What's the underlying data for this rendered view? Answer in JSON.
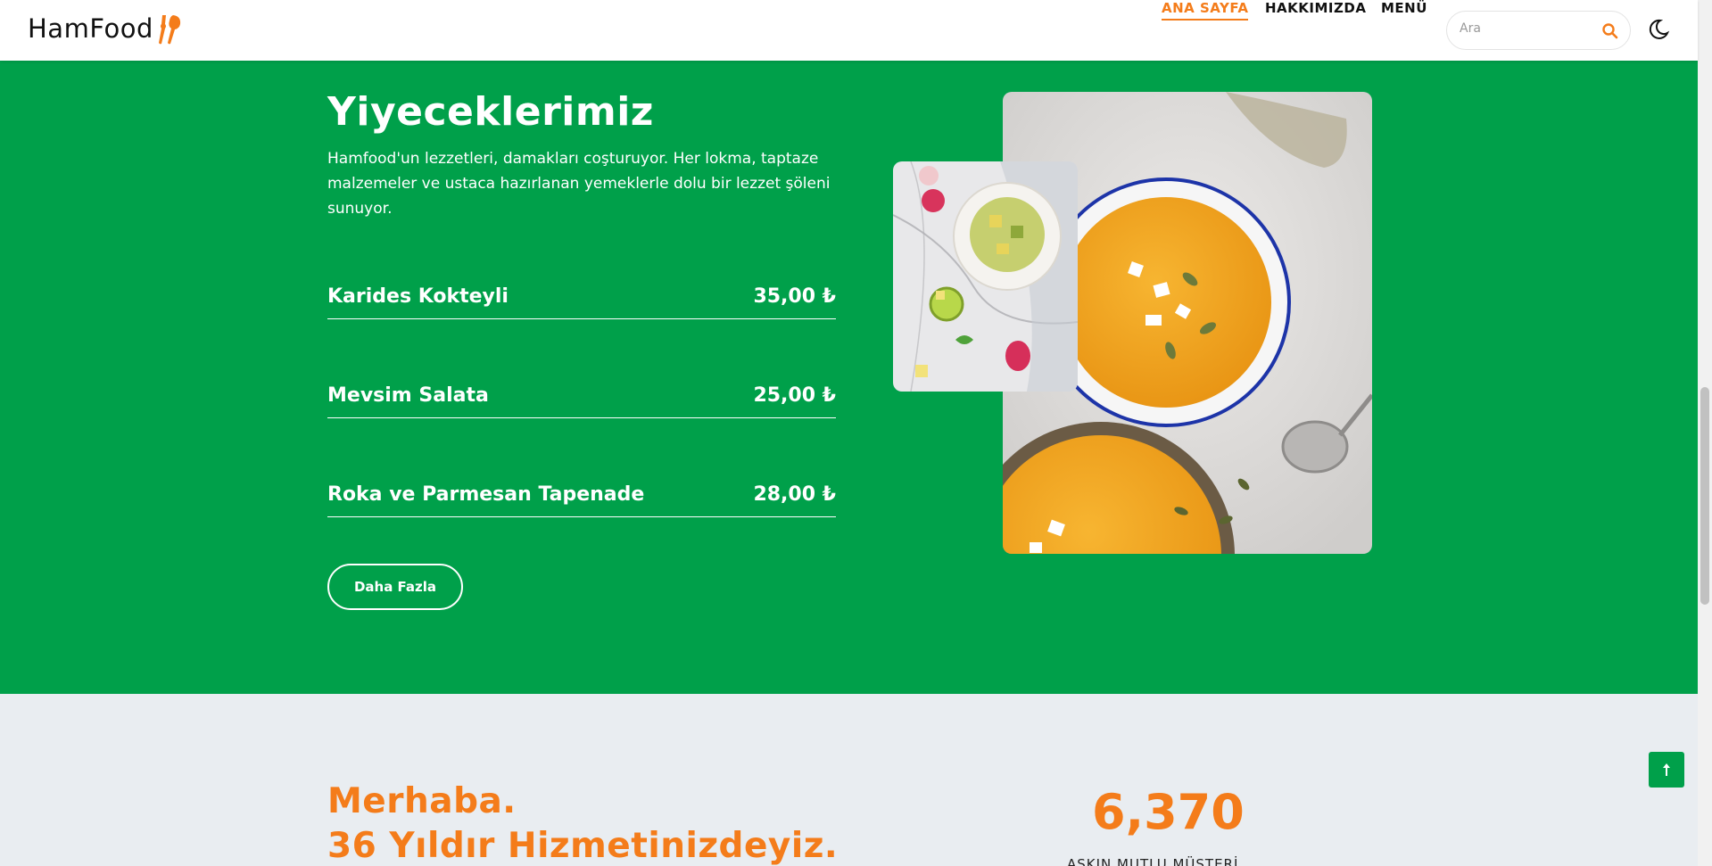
{
  "header": {
    "logo_text": "HamFood",
    "nav": [
      {
        "label": "ANA SAYFA",
        "active": true
      },
      {
        "label": "HAKKIMIZDA",
        "active": false
      },
      {
        "label": "MENÜ",
        "active": false
      }
    ],
    "search_placeholder": "Ara",
    "accent_color": "#f47c1a"
  },
  "foods": {
    "title": "Yiyeceklerimiz",
    "description": "Hamfood'un lezzetleri, damakları coşturuyor. Her lokma, taptaze malzemeler ve ustaca hazırlanan yemeklerle dolu bir lezzet şöleni sunuyor.",
    "items": [
      {
        "name": "Karides Kokteyli",
        "price": "35,00 ₺"
      },
      {
        "name": "Mevsim Salata",
        "price": "25,00 ₺"
      },
      {
        "name": "Roka ve Parmesan Tapenade",
        "price": "28,00 ₺"
      }
    ],
    "more_button": "Daha Fazla",
    "bg_color": "#00a04a"
  },
  "about": {
    "line1": "Merhaba.",
    "line2": "36 Yıldır Hizmetinizdeyiz.",
    "stat_value": "6,370",
    "stat_label": "AŞKIN MUTLU MÜŞTERİ"
  }
}
